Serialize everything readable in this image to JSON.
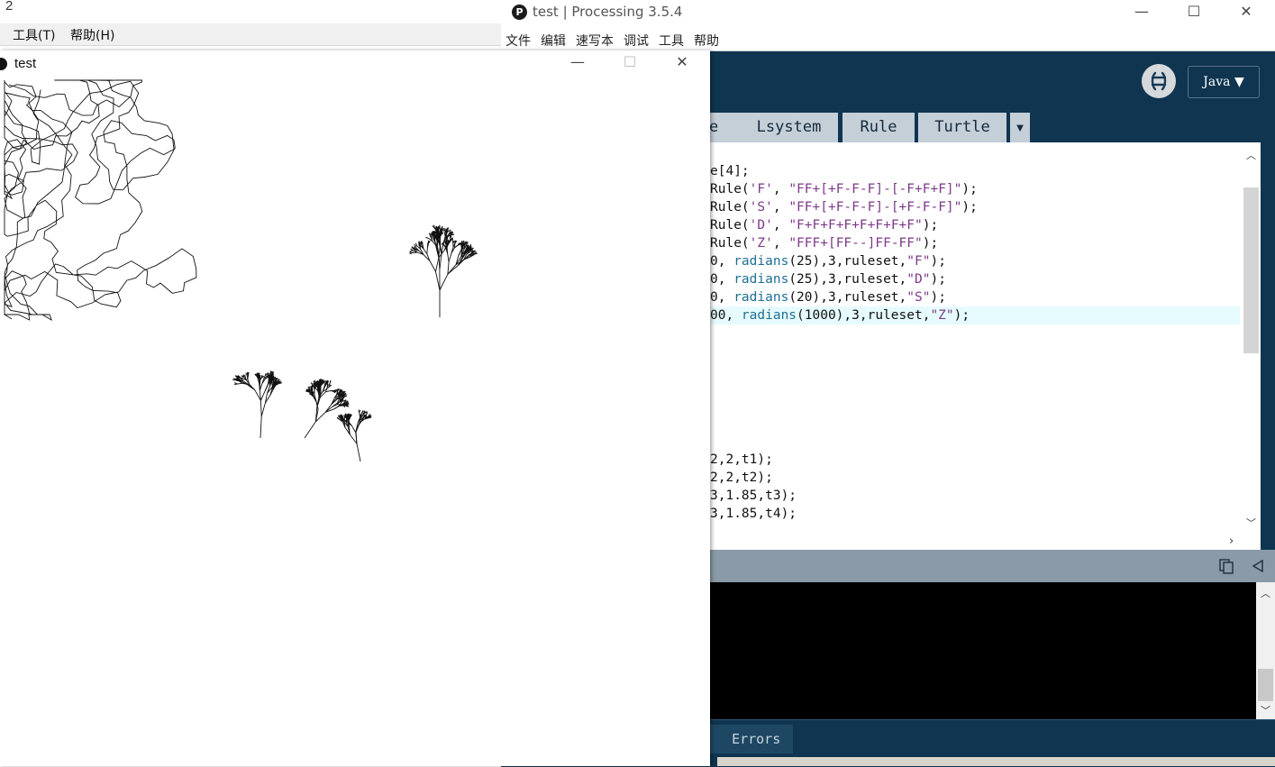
{
  "bg_window": {
    "title": "2",
    "menu": [
      "工具(T)",
      "帮助(H)"
    ]
  },
  "ide": {
    "title": "test | Processing 3.5.4",
    "window_buttons": {
      "minimize": "—",
      "maximize": "☐",
      "close": "✕"
    },
    "menu": [
      "文件",
      "编辑",
      "速写本",
      "调试",
      "工具",
      "帮助"
    ],
    "mode_button": "Java ▼",
    "tabs": [
      "e",
      "Lsystem",
      "Rule",
      "Turtle"
    ],
    "tab_more": "▼",
    "code_lines": [
      [
        {
          "t": "e[4];",
          "c": ""
        }
      ],
      [
        {
          "t": "Rule(",
          "c": ""
        },
        {
          "t": "'F'",
          "c": "str"
        },
        {
          "t": ", ",
          "c": ""
        },
        {
          "t": "\"FF+[+F-F-F]-[-F+F+F]\"",
          "c": "str"
        },
        {
          "t": ");",
          "c": ""
        }
      ],
      [
        {
          "t": "Rule(",
          "c": ""
        },
        {
          "t": "'S'",
          "c": "str"
        },
        {
          "t": ", ",
          "c": ""
        },
        {
          "t": "\"FF+[+F-F-F]-[+F-F-F]\"",
          "c": "str"
        },
        {
          "t": ");",
          "c": ""
        }
      ],
      [
        {
          "t": "Rule(",
          "c": ""
        },
        {
          "t": "'D'",
          "c": "str"
        },
        {
          "t": ", ",
          "c": ""
        },
        {
          "t": "\"F+F+F+F+F+F+F+F\"",
          "c": "str"
        },
        {
          "t": ");",
          "c": ""
        }
      ],
      [
        {
          "t": "Rule(",
          "c": ""
        },
        {
          "t": "'Z'",
          "c": "str"
        },
        {
          "t": ", ",
          "c": ""
        },
        {
          "t": "\"FFF+[FF--]FF-FF\"",
          "c": "str"
        },
        {
          "t": ");",
          "c": ""
        }
      ],
      [
        {
          "t": "0, ",
          "c": ""
        },
        {
          "t": "radians",
          "c": "kw"
        },
        {
          "t": "(25),3,ruleset,",
          "c": ""
        },
        {
          "t": "\"F\"",
          "c": "str"
        },
        {
          "t": ");",
          "c": ""
        }
      ],
      [
        {
          "t": "0, ",
          "c": ""
        },
        {
          "t": "radians",
          "c": "kw"
        },
        {
          "t": "(25),3,ruleset,",
          "c": ""
        },
        {
          "t": "\"D\"",
          "c": "str"
        },
        {
          "t": ");",
          "c": ""
        }
      ],
      [
        {
          "t": "0, ",
          "c": ""
        },
        {
          "t": "radians",
          "c": "kw"
        },
        {
          "t": "(20),3,ruleset,",
          "c": ""
        },
        {
          "t": "\"S\"",
          "c": "str"
        },
        {
          "t": ");",
          "c": ""
        }
      ],
      [
        {
          "t": "00, ",
          "c": ""
        },
        {
          "t": "radians",
          "c": "kw"
        },
        {
          "t": "(1000),3,ruleset,",
          "c": ""
        },
        {
          "t": "\"Z\"",
          "c": "str"
        },
        {
          "t": ");",
          "c": ""
        }
      ],
      [],
      [],
      [],
      [],
      [],
      [],
      [],
      [
        {
          "t": "2,2,t1);",
          "c": ""
        }
      ],
      [
        {
          "t": "2,2,t2);",
          "c": ""
        }
      ],
      [
        {
          "t": "3,1.85,t3);",
          "c": ""
        }
      ],
      [
        {
          "t": "3,1.85,t4);",
          "c": ""
        }
      ]
    ],
    "highlighted_line": 8,
    "console_tab": "Errors"
  },
  "sketch": {
    "title": "test",
    "window_buttons": {
      "minimize": "—",
      "maximize": "☐",
      "close": "✕"
    }
  },
  "colors": {
    "ide_bg": "#0f3550",
    "tab_bg": "#c4cfd8",
    "string": "#7c3a88",
    "keyword": "#1f6f93",
    "highlight": "#e6fbfd"
  }
}
